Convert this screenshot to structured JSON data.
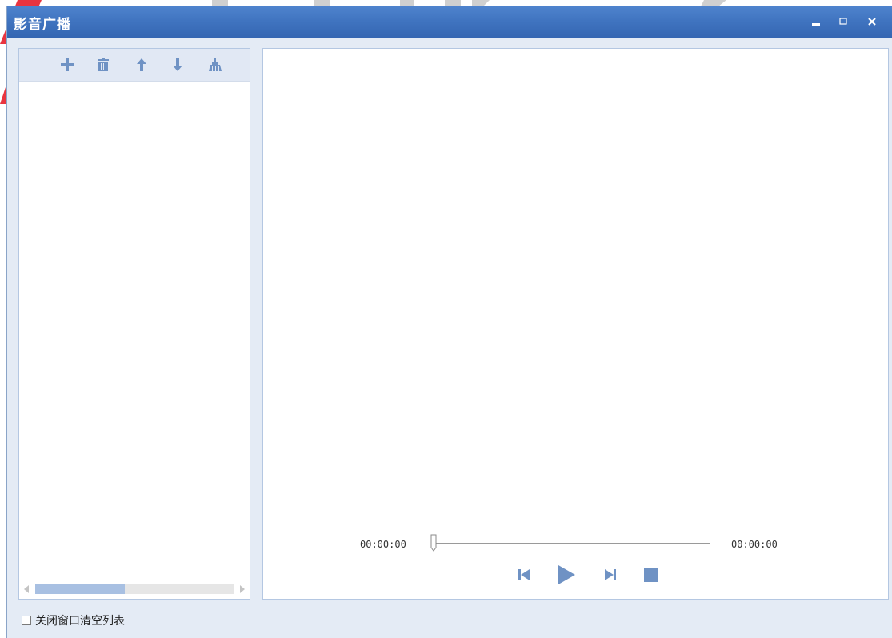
{
  "window": {
    "title": "影音广播",
    "buttons": {
      "minimize": "minimize-icon",
      "maximize": "maximize-icon",
      "close": "close-icon"
    }
  },
  "playlist_toolbar": {
    "icons": [
      "plus-icon",
      "trash-icon",
      "arrow-up-icon",
      "arrow-down-icon",
      "broom-icon"
    ]
  },
  "playlist": {
    "items": [],
    "scroll_position": 0.0,
    "scroll_visible_fraction": 0.45
  },
  "player": {
    "current_time": "00:00:00",
    "total_time": "00:00:00",
    "progress": 0.0,
    "controls": [
      "previous-icon",
      "play-icon",
      "next-icon",
      "stop-icon"
    ]
  },
  "footer": {
    "checkbox_label": "关闭窗口清空列表",
    "checked": false
  },
  "colors": {
    "titlebar": "#3f73bf",
    "window_bg": "#e4ebf5",
    "icon": "#6f92c4",
    "panel_border": "#b4c7e2",
    "watermark": "#e9343f"
  }
}
